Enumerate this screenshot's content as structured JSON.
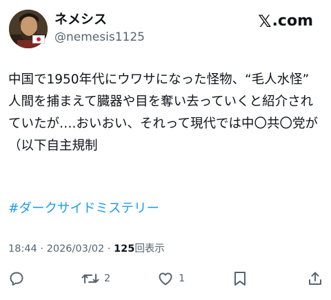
{
  "user": {
    "display_name": "ネメシス",
    "handle": "@nemesis1125",
    "avatar": "avatar-portrait",
    "flag": "japan-flag"
  },
  "brand": {
    "x_glyph": "𝕏",
    "text": ".com"
  },
  "tweet": {
    "text": "中国で1950年代にウワサになった怪物、“毛人水怪”\n人間を捕まえて臓器や目を奪い去っていくと紹介されていたが….おいおい、それって現代では中〇共〇党が（以下自主規制",
    "hashtag": "#ダークサイドミステリー"
  },
  "meta": {
    "time": "18:44",
    "date": "2026/03/02",
    "separator": " · ",
    "views_count": "125",
    "views_label": "回表示"
  },
  "actions": {
    "reply_icon": "reply-icon",
    "retweet_icon": "retweet-icon",
    "retweet_count": "2",
    "like_icon": "heart-icon",
    "like_count": "1",
    "bookmark_icon": "bookmark-icon",
    "share_icon": "share-icon"
  },
  "colors": {
    "text": "#0f1419",
    "secondary": "#536471",
    "link": "#1d9bf0"
  }
}
